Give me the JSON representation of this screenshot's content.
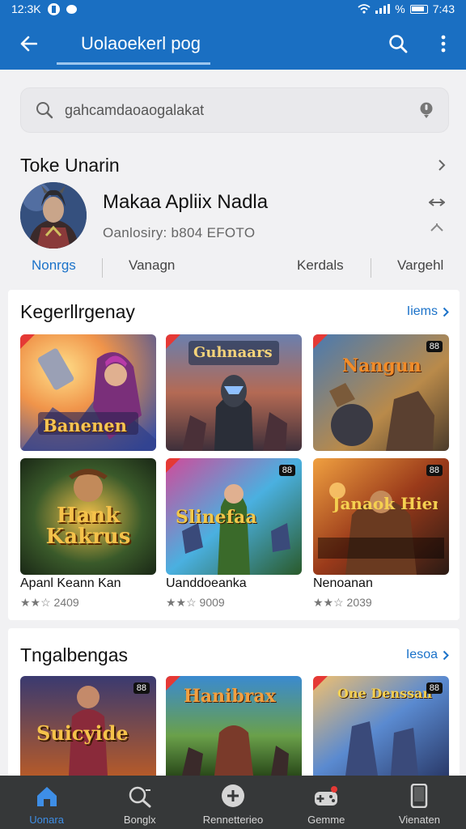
{
  "status": {
    "time_left": "12:3K",
    "time_right": "7:43",
    "battery_symbol": "%"
  },
  "appbar": {
    "title": "Uolaoekerl pog"
  },
  "search": {
    "value": "gahcamdaoaogalakat"
  },
  "section1": {
    "title": "Toke Unarin"
  },
  "profile": {
    "name": "Makaa Apliix Nadla",
    "subtitle": "Oanlosiry: b804 EFOTO"
  },
  "tabs": [
    "Nonrgs",
    "Vanagn",
    "Kerdals",
    "Vargehl"
  ],
  "section2": {
    "title": "Kegerllrgenay",
    "more": "Iiems"
  },
  "games": [
    {
      "badge": "",
      "art": "Banenen",
      "tint": "#5a7fd8"
    },
    {
      "badge": "",
      "art": "Guhnaars",
      "tint": "#b4563a"
    },
    {
      "badge": "88",
      "art": "Nangun",
      "tint": "#3f6a8a"
    },
    {
      "badge": "",
      "art": "Hank Kakrus",
      "tint": "#21422a",
      "title": "Apanl Keann Kan",
      "rating": "2409"
    },
    {
      "badge": "88",
      "art": "Slinefaa",
      "tint": "#b33f8a",
      "title": "Uanddoeanka",
      "rating": "9009"
    },
    {
      "badge": "88",
      "art": "Janaok Hienein Nak",
      "tint": "#7a2f1c",
      "title": "Nenoanan",
      "rating": "2039"
    }
  ],
  "section3": {
    "title": "Tngalbengas",
    "more": "Iesoa"
  },
  "games2": [
    {
      "badge": "88",
      "art": "Suicyide",
      "tint": "#3a3960"
    },
    {
      "badge": "",
      "art": "Hanibrax",
      "tint": "#c4482c"
    },
    {
      "badge": "88",
      "art": "One Denssan",
      "tint": "#3f7ac8"
    }
  ],
  "nav": [
    {
      "label": "Uonara",
      "icon": "home-icon"
    },
    {
      "label": "Bonglx",
      "icon": "search-icon"
    },
    {
      "label": "Rennetterieo",
      "icon": "compass-icon"
    },
    {
      "label": "Gemme",
      "icon": "gamepad-icon"
    },
    {
      "label": "Vienaten",
      "icon": "phone-icon"
    }
  ],
  "colors": {
    "primary": "#1a6fc2",
    "link": "#1b72c9",
    "navbar": "#363839"
  }
}
